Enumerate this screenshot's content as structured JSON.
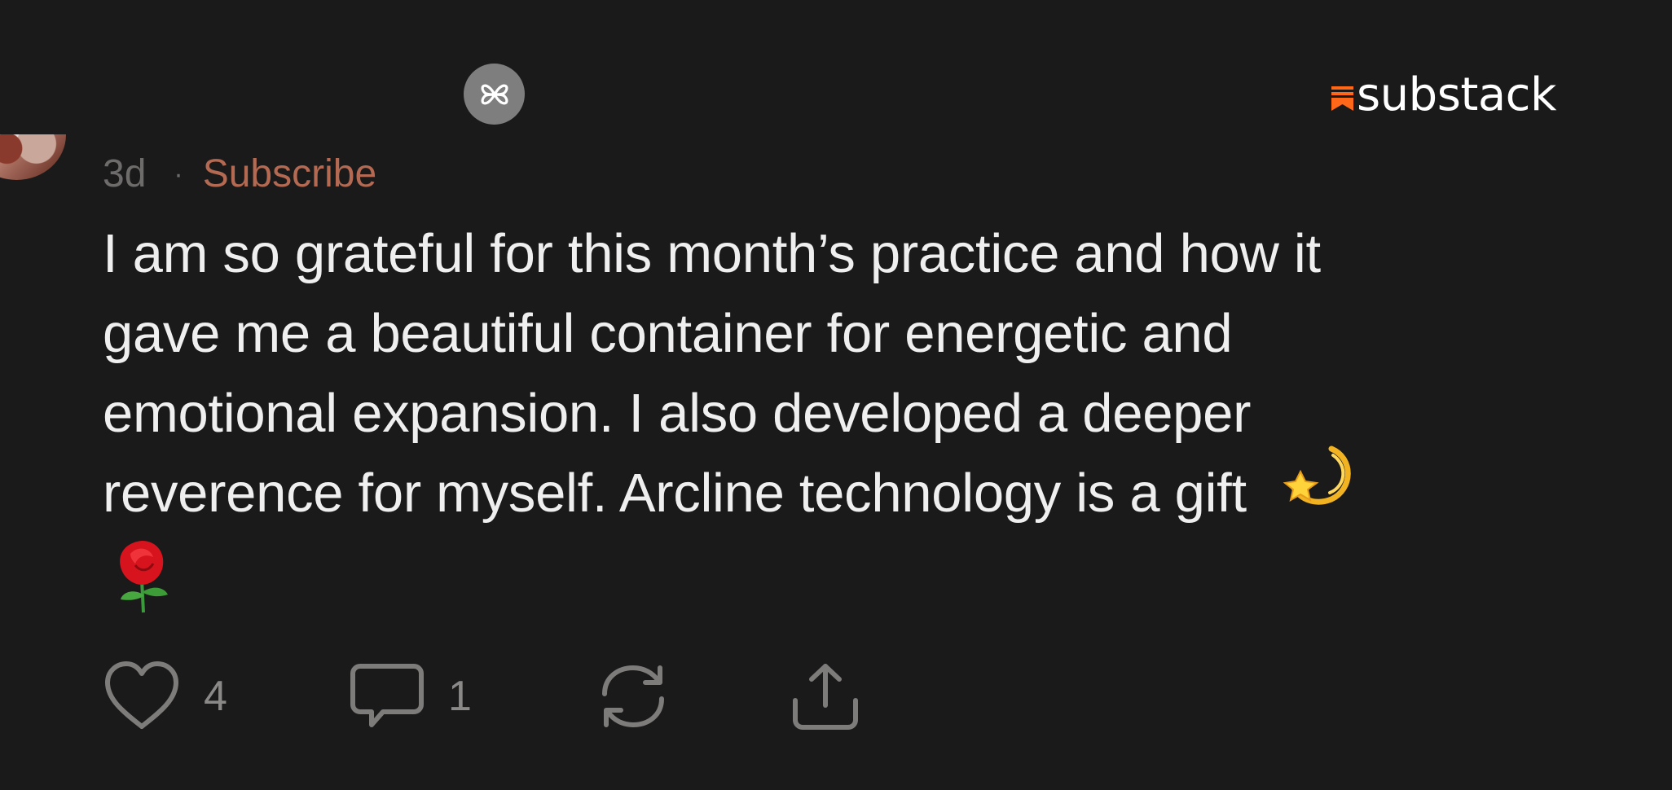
{
  "header": {
    "app_icon": "flower-icon",
    "brand": {
      "name": "substack",
      "icon": "substack-bookmark-icon",
      "accent_color": "#FF6719"
    }
  },
  "comment": {
    "time_ago": "3d",
    "separator": "·",
    "subscribe_label": "Subscribe",
    "body_lines": [
      "I am so grateful for this month’s practice and how it",
      "gave me a beautiful container for energetic and",
      "emotional expansion. I also developed a deeper",
      "reverence for myself. Arcline technology is a gift"
    ],
    "emojis": [
      "dizzy-star-emoji",
      "rose-emoji"
    ]
  },
  "actions": {
    "like": {
      "icon": "heart-icon",
      "count": "4"
    },
    "comment": {
      "icon": "speech-bubble-icon",
      "count": "1"
    },
    "restack": {
      "icon": "restack-icon"
    },
    "share": {
      "icon": "share-icon"
    }
  },
  "colors": {
    "background": "#1b1a1a",
    "text": "#efefef",
    "muted": "#6e6c6b",
    "subscribe": "#b46a52"
  }
}
